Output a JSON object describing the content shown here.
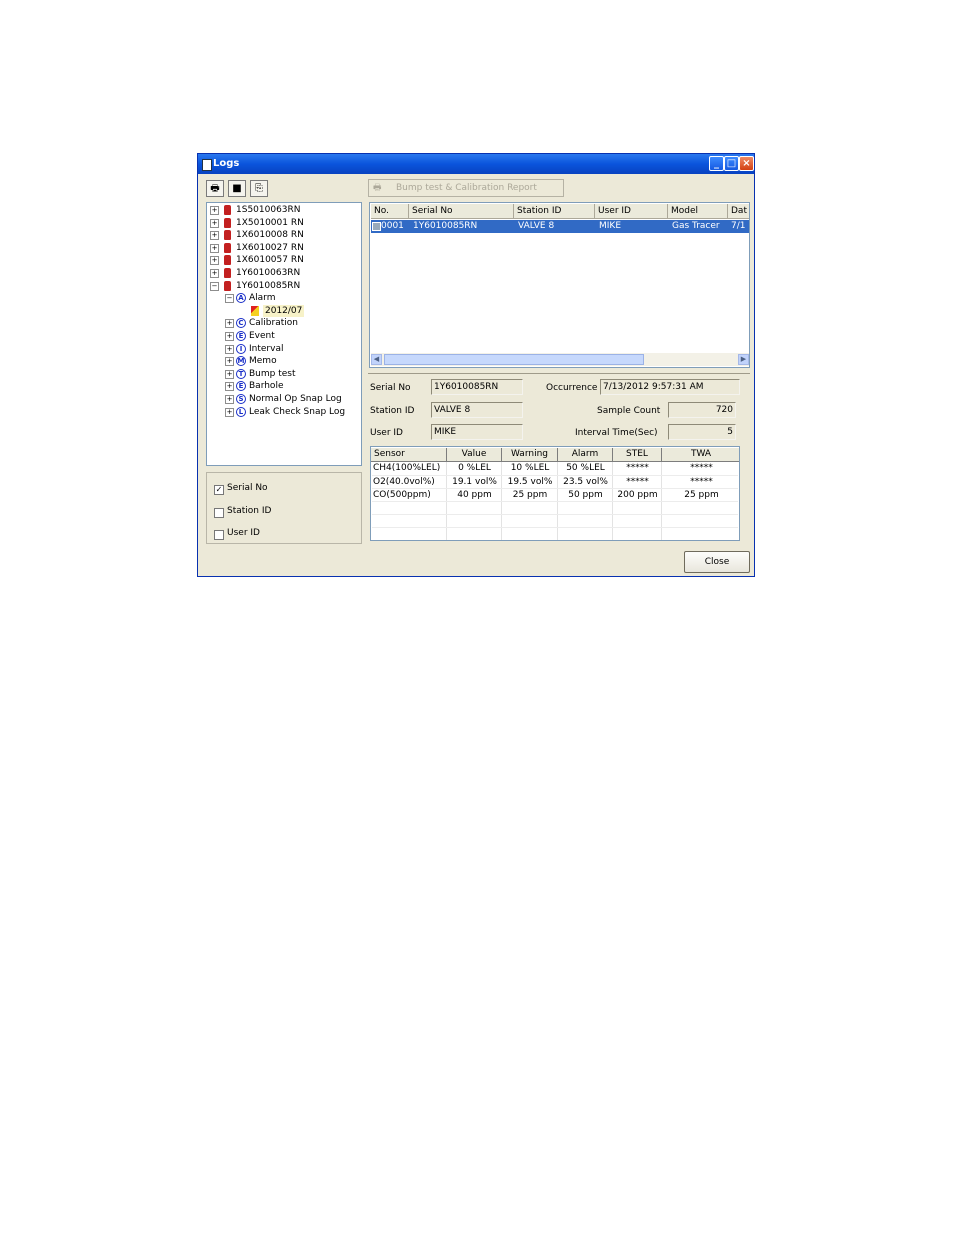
{
  "window": {
    "title": "Logs"
  },
  "toolbar": {
    "print_icon": "printer-icon",
    "save_icon": "floppy-disk-icon",
    "clipboard_icon": "clipboard-icon",
    "report_button": "Bump test & Calibration Report"
  },
  "tree": {
    "devices": [
      "1S5010063RN",
      "1X5010001 RN",
      "1X6010008 RN",
      "1X6010027 RN",
      "1X6010057 RN",
      "1Y6010063RN",
      "1Y6010085RN"
    ],
    "categories": [
      {
        "letter": "A",
        "label": "Alarm"
      },
      {
        "letter": "C",
        "label": "Calibration"
      },
      {
        "letter": "E",
        "label": "Event"
      },
      {
        "letter": "I",
        "label": "Interval"
      },
      {
        "letter": "M",
        "label": "Memo"
      },
      {
        "letter": "T",
        "label": "Bump test"
      },
      {
        "letter": "E",
        "label": "Barhole"
      },
      {
        "letter": "S",
        "label": "Normal Op Snap Log"
      },
      {
        "letter": "L",
        "label": "Leak Check Snap Log"
      }
    ],
    "alarm_child": "2012/07"
  },
  "filters": [
    {
      "label": "Serial No",
      "checked": true
    },
    {
      "label": "Station ID",
      "checked": false
    },
    {
      "label": "User ID",
      "checked": false
    }
  ],
  "list": {
    "headers": [
      "No.",
      "Serial No",
      "Station ID",
      "User ID",
      "Model",
      "Dat"
    ],
    "row": [
      "0001",
      "1Y6010085RN",
      "VALVE 8",
      "MIKE",
      "Gas Tracer",
      "7/1"
    ]
  },
  "details": {
    "serial_no_label": "Serial No",
    "serial_no": "1Y6010085RN",
    "station_id_label": "Station ID",
    "station_id": "VALVE 8",
    "user_id_label": "User ID",
    "user_id": "MIKE",
    "occurrence_label": "Occurrence",
    "occurrence": "7/13/2012 9:57:31 AM",
    "sample_count_label": "Sample Count",
    "sample_count": "720",
    "interval_label": "Interval Time(Sec)",
    "interval": "5"
  },
  "sensor_table": {
    "headers": [
      "Sensor",
      "Value",
      "Warning",
      "Alarm",
      "STEL",
      "TWA"
    ],
    "rows": [
      [
        "CH4(100%LEL)",
        "0 %LEL",
        "10 %LEL",
        "50 %LEL",
        "*****",
        "*****"
      ],
      [
        "O2(40.0vol%)",
        "19.1 vol%",
        "19.5 vol%",
        "23.5 vol%",
        "*****",
        "*****"
      ],
      [
        "CO(500ppm)",
        "40 ppm",
        "25 ppm",
        "50 ppm",
        "200 ppm",
        "25 ppm"
      ]
    ]
  },
  "buttons": {
    "close": "Close"
  }
}
